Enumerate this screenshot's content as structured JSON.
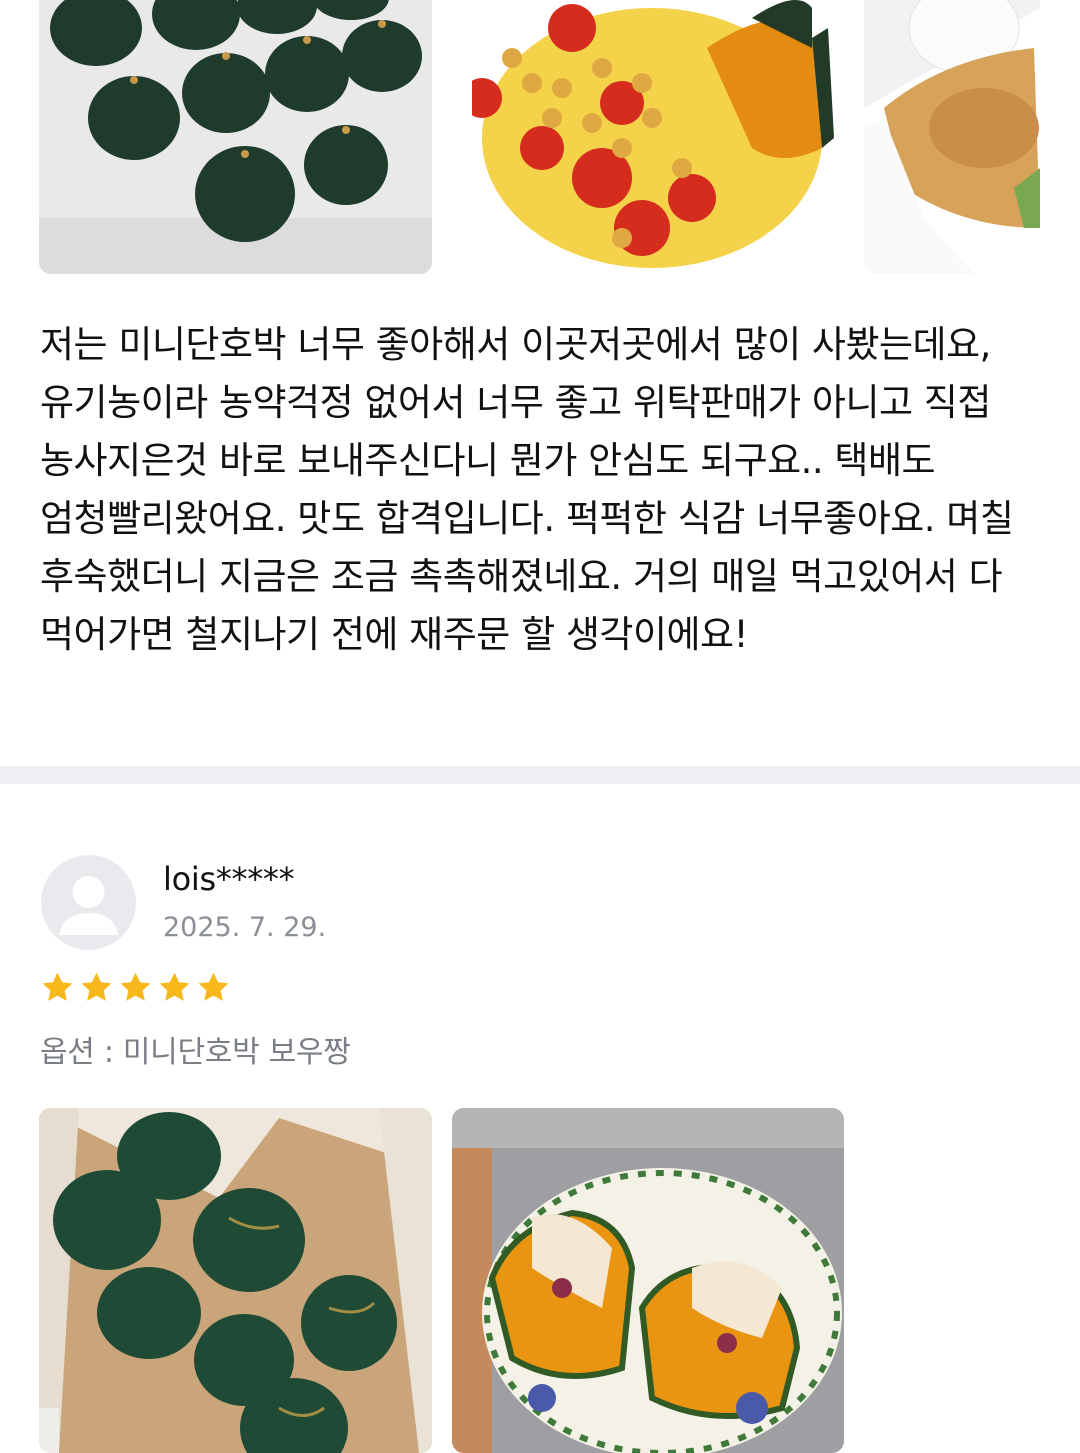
{
  "previous_review": {
    "photos": [
      {
        "icon": "pumpkins-on-white-cloth-photo"
      },
      {
        "icon": "chickpea-tomato-pumpkin-bowl-photo"
      },
      {
        "icon": "salad-with-egg-photo"
      }
    ],
    "text": "저는 미니단호박 너무 좋아해서 이곳저곳에서 많이 사봤는데요, 유기농이라 농약걱정 없어서 너무 좋고 위탁판매가 아니고 직접 농사지은것 바로 보내주신다니 뭔가 안심도 되구요.. 택배도 엄청빨리왔어요. 맛도 합격입니다. 퍽퍽한 식감 너무좋아요. 며칠 후숙했더니 지금은 조금 촉촉해졌네요. 거의 매일 먹고있어서 다 먹어가면 철지나기 전에 재주문 할 생각이에요!"
  },
  "review": {
    "username": "lois*****",
    "date": "2025. 7. 29.",
    "rating": 5,
    "option_text": "옵션 : 미니단호박 보우짱",
    "photos": [
      {
        "icon": "pumpkins-in-box-photo"
      },
      {
        "icon": "stuffed-pumpkin-plate-photo"
      }
    ]
  },
  "colors": {
    "star": "#f6b81a",
    "divider": "#eeeff2",
    "muted_text": "#8b8f96",
    "avatar_bg": "#e9eaee"
  }
}
